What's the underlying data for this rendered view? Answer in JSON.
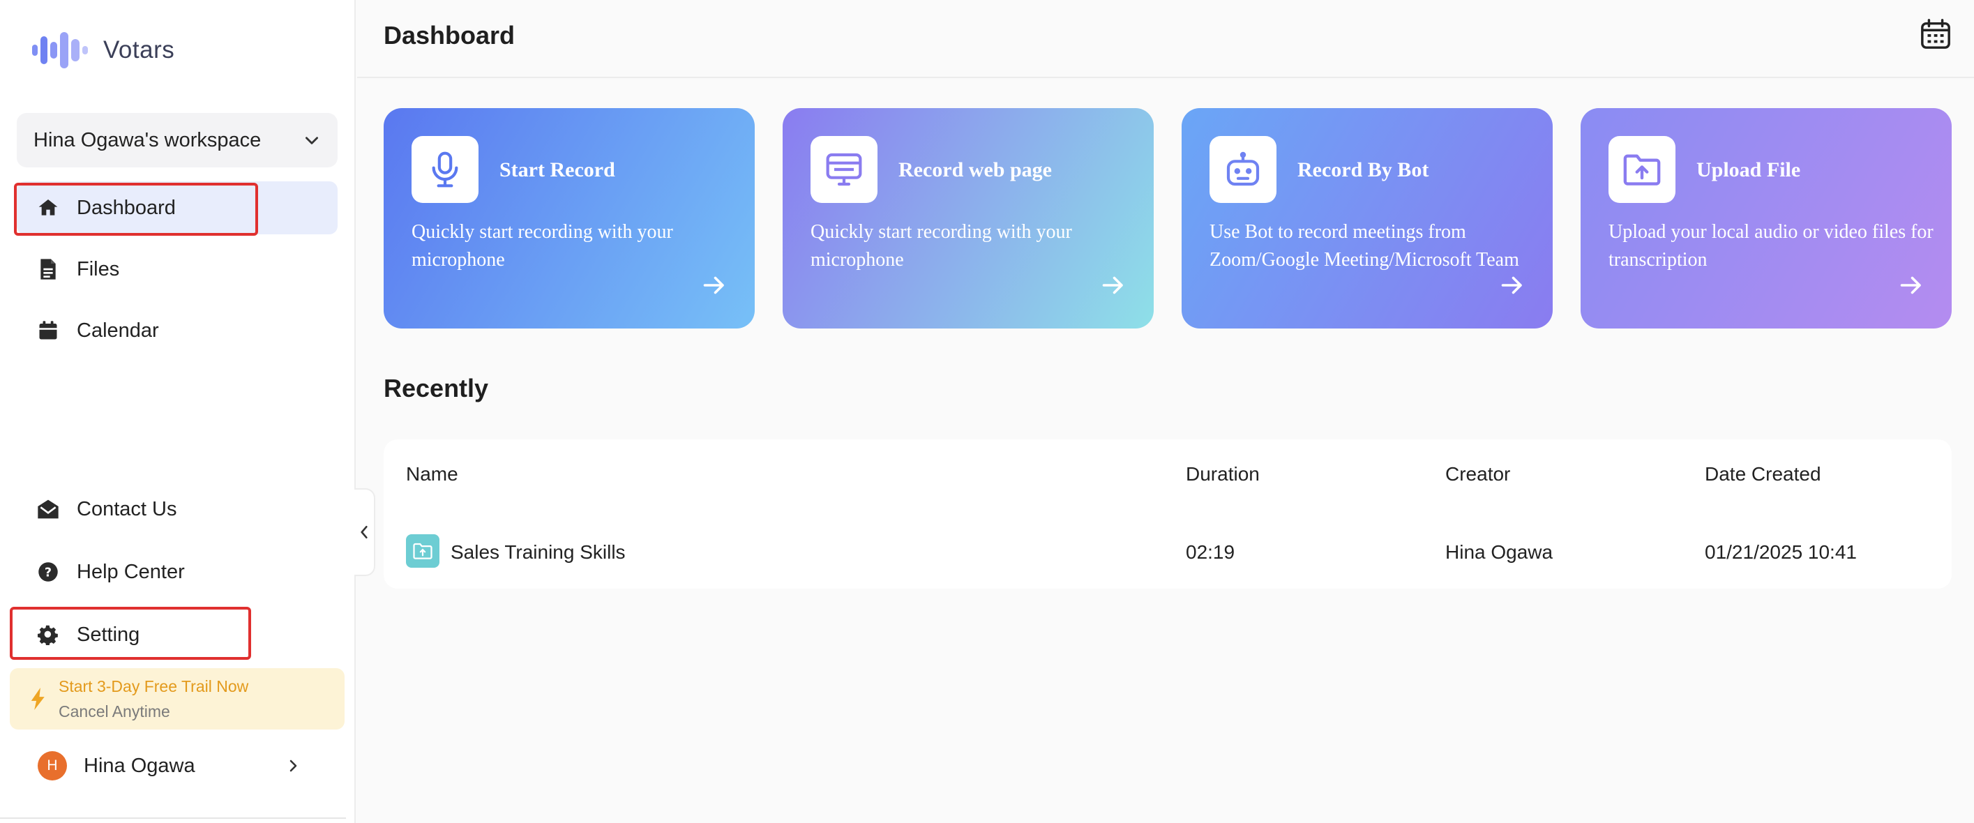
{
  "app": {
    "name": "Votars"
  },
  "colors": {
    "accent": "#5a78f0",
    "active_bg": "#e8edfc",
    "highlight": "#e0302f",
    "trial_text": "#e39a1c",
    "trial_bg": "#fdf3d6",
    "avatar_bg": "#e86f2c"
  },
  "sidebar": {
    "workspace": {
      "name": "Hina Ogawa's workspace",
      "icon": "chevron-down-icon"
    },
    "nav": [
      {
        "label": "Dashboard",
        "icon": "home-icon",
        "active": true
      },
      {
        "label": "Files",
        "icon": "file-icon"
      },
      {
        "label": "Calendar",
        "icon": "calendar-icon"
      }
    ],
    "bottom": [
      {
        "label": "Contact Us",
        "icon": "mail-open-icon"
      },
      {
        "label": "Help Center",
        "icon": "help-circle-icon"
      },
      {
        "label": "Setting",
        "icon": "gear-icon"
      }
    ],
    "trial": {
      "title": "Start 3-Day Free Trail Now",
      "subtitle": "Cancel Anytime",
      "icon": "lightning-icon"
    },
    "user": {
      "initial": "H",
      "name": "Hina Ogawa",
      "icon": "chevron-right-icon"
    }
  },
  "header": {
    "title": "Dashboard",
    "calendar_icon": "calendar-icon"
  },
  "cards": [
    {
      "title": "Start Record",
      "description": "Quickly start recording with your microphone",
      "icon": "microphone-icon",
      "gradient": [
        "#5a78f0",
        "#77c0f7"
      ]
    },
    {
      "title": "Record web page",
      "description": "Quickly start recording with your microphone",
      "icon": "monitor-icon",
      "gradient": [
        "#8a7cf0",
        "#8ee0e8"
      ]
    },
    {
      "title": "Record By Bot",
      "description": "Use Bot to record meetings from Zoom/Google Meeting/Microsoft Team",
      "icon": "robot-icon",
      "gradient": [
        "#6aa6f6",
        "#8a7cf0"
      ]
    },
    {
      "title": "Upload File",
      "description": "Upload your local audio or video files for transcription",
      "icon": "folder-upload-icon",
      "gradient": [
        "#8a8cf3",
        "#b48cf0"
      ]
    }
  ],
  "recent": {
    "title": "Recently",
    "columns": [
      "Name",
      "Duration",
      "Creator",
      "Date Created"
    ],
    "rows": [
      {
        "name": "Sales Training Skills",
        "duration": "02:19",
        "creator": "Hina Ogawa",
        "date": "01/21/2025 10:41"
      }
    ]
  }
}
